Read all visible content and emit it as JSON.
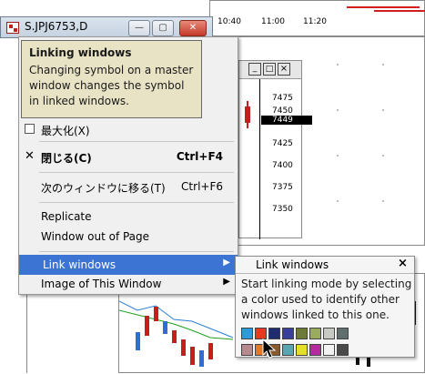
{
  "background_windows": {
    "top_axis_labels": [
      "10:40",
      "11:00",
      "11:20"
    ],
    "right_axis_prices": [
      "7475",
      "7450",
      "7449",
      "7425",
      "7400",
      "7375",
      "7350"
    ],
    "small_window_buttons": [
      "_",
      "□",
      "×"
    ]
  },
  "front_window": {
    "title": "S.JPJ6753,D",
    "buttons": {
      "minimize": "—",
      "maximize": "▢",
      "close": "✕"
    }
  },
  "tooltip": {
    "title": "Linking windows",
    "body": "Changing symbol on a master window changes the symbol in linked windows."
  },
  "menu": {
    "maximize": {
      "label": "最大化(X)"
    },
    "close": {
      "label": "閉じる(C)",
      "shortcut": "Ctrl+F4"
    },
    "next_window": {
      "label": "次のウィンドウに移る(T)",
      "shortcut": "Ctrl+F6"
    },
    "replicate": {
      "label": "Replicate"
    },
    "window_out_of_page": {
      "label": "Window out of Page"
    },
    "link_windows": {
      "label": "Link windows"
    },
    "image_of_window": {
      "label": "Image of This Window"
    }
  },
  "link_panel": {
    "title": "Link windows",
    "close": "×",
    "description": "Start linking mode by selecting a color used to identify other windows linked to this one.",
    "colors_row1": [
      "#2f9ad6",
      "#e63a1f",
      "#1f2d6e",
      "#3a3f9c",
      "#6e7a3a",
      "#9aaa5e",
      "#c7c9c3",
      "#5f6f6e"
    ],
    "colors_row2": [
      "#b78a8f",
      "#e07a2a",
      "#8a5a2a",
      "#5aa6b0",
      "#e4e02a",
      "#b52a9c",
      "#f2f2f2",
      "#4a4a4a"
    ]
  }
}
